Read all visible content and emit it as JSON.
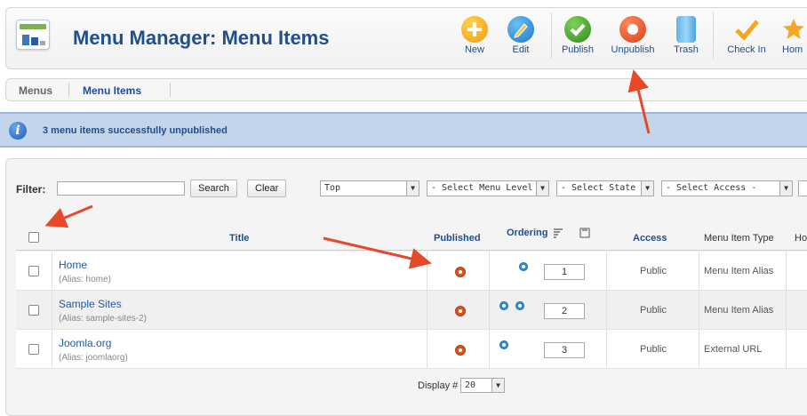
{
  "header": {
    "title": "Menu Manager: Menu Items",
    "toolbar": [
      {
        "name": "new-button",
        "label": "New",
        "icon": "plus-icon",
        "color": "#f5a623"
      },
      {
        "name": "edit-button",
        "label": "Edit",
        "icon": "pencil-icon",
        "color": "#2d8fd8"
      },
      {
        "name": "publish-button",
        "label": "Publish",
        "icon": "check-icon",
        "color": "#4aa02c"
      },
      {
        "name": "unpublish-button",
        "label": "Unpublish",
        "icon": "circle-icon",
        "color": "#e2551f"
      },
      {
        "name": "trash-button",
        "label": "Trash",
        "icon": "trash-icon",
        "color": "#4aa3df"
      },
      {
        "name": "checkin-button",
        "label": "Check In",
        "icon": "checkmark-icon",
        "color": "#f5a623"
      },
      {
        "name": "home-button",
        "label": "Hom",
        "icon": "star-icon",
        "color": "#f5a623"
      }
    ]
  },
  "submenu": {
    "menus": "Menus",
    "menu_items": "Menu Items"
  },
  "message": {
    "text": "3 menu items successfully unpublished"
  },
  "filters": {
    "filter_label": "Filter:",
    "filter_value": "",
    "search_label": "Search",
    "clear_label": "Clear",
    "menu_select": "Top",
    "level_select": "- Select Menu Level -",
    "state_select": "- Select State -",
    "access_select": "- Select Access -"
  },
  "table": {
    "columns": {
      "title": "Title",
      "published": "Published",
      "ordering": "Ordering",
      "access": "Access",
      "type": "Menu Item Type",
      "home": "Ho"
    },
    "rows": [
      {
        "title": "Home",
        "alias": "(Alias: home)",
        "order": "1",
        "access": "Public",
        "type": "Menu Item Alias"
      },
      {
        "title": "Sample Sites",
        "alias": "(Alias: sample-sites-2)",
        "order": "2",
        "access": "Public",
        "type": "Menu Item Alias"
      },
      {
        "title": "Joomla.org",
        "alias": "(Alias: joomlaorg)",
        "order": "3",
        "access": "Public",
        "type": "External URL"
      }
    ]
  },
  "pagination": {
    "display_label": "Display #",
    "display_value": "20"
  },
  "colors": {
    "annotation_arrow": "#e8482a",
    "title_blue": "#1e4f8f",
    "message_bg": "#c3d5ea"
  }
}
